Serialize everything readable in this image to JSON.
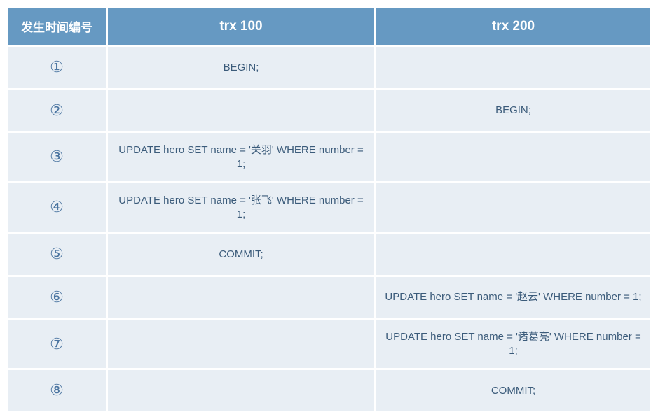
{
  "headers": {
    "time": "发生时间编号",
    "trx100": "trx 100",
    "trx200": "trx 200"
  },
  "rows": [
    {
      "idx": "①",
      "trx100": "BEGIN;",
      "trx200": ""
    },
    {
      "idx": "②",
      "trx100": "",
      "trx200": "BEGIN;"
    },
    {
      "idx": "③",
      "trx100": "UPDATE hero SET name = '关羽' WHERE number = 1;",
      "trx200": ""
    },
    {
      "idx": "④",
      "trx100": "UPDATE hero SET name = '张飞' WHERE number = 1;",
      "trx200": ""
    },
    {
      "idx": "⑤",
      "trx100": "COMMIT;",
      "trx200": ""
    },
    {
      "idx": "⑥",
      "trx100": "",
      "trx200": "UPDATE hero SET name = '赵云' WHERE number = 1;"
    },
    {
      "idx": "⑦",
      "trx100": "",
      "trx200": "UPDATE hero SET name = '诸葛亮' WHERE number = 1;"
    },
    {
      "idx": "⑧",
      "trx100": "",
      "trx200": "COMMIT;"
    }
  ]
}
